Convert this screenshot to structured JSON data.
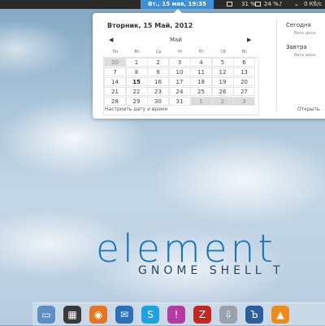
{
  "topbar": {
    "clock": "Вт., 15 мая, 19:35",
    "battery_percent": "31 %",
    "volume_percent": "24 %",
    "network_speed": "0 Кб/с"
  },
  "calendar": {
    "date_title": "Вторник, 15 Май, 2012",
    "month": "Май",
    "prev_symbol": "◀",
    "next_symbol": "▶",
    "weekdays": [
      "Пн",
      "Вт",
      "Ср",
      "Чт",
      "Пт",
      "Сб",
      "Вс"
    ],
    "weeks": [
      [
        "30",
        "1",
        "2",
        "3",
        "4",
        "5",
        "6"
      ],
      [
        "7",
        "8",
        "9",
        "10",
        "11",
        "12",
        "13"
      ],
      [
        "14",
        "15",
        "16",
        "17",
        "18",
        "19",
        "20"
      ],
      [
        "21",
        "22",
        "23",
        "24",
        "25",
        "26",
        "27"
      ],
      [
        "28",
        "29",
        "30",
        "31",
        "1",
        "2",
        "3"
      ]
    ],
    "today": "15",
    "settings_link": "Настроить дату и время"
  },
  "events": {
    "today_label": "Сегодня",
    "today_sub": "Весь день",
    "tomorrow_label": "Завтра",
    "tomorrow_sub": "Весь день",
    "open_link": "Открыть"
  },
  "desktop": {
    "logo": "element",
    "tagline": "GNOME SHELL T"
  },
  "dock": {
    "icons": [
      "files-icon",
      "calculator-icon",
      "firefox-icon",
      "thunderbird-icon",
      "skype-icon",
      "pidgin-icon",
      "filezilla-icon",
      "transmission-icon",
      "text-icon",
      "vlc-icon"
    ]
  },
  "colors": {
    "accent": "#3d8fd6",
    "logo": "#1a74b8"
  }
}
